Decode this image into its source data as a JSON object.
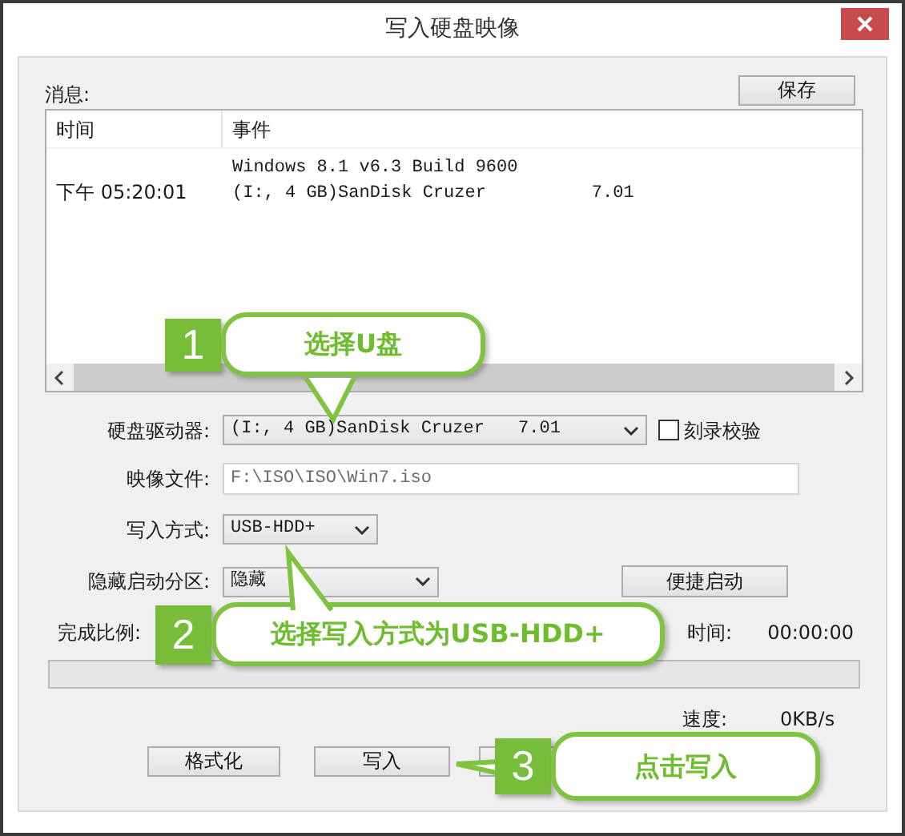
{
  "window": {
    "title": "写入硬盘映像"
  },
  "messages": {
    "label": "消息:",
    "save_button": "保存",
    "columns": [
      "时间",
      "事件"
    ],
    "rows": [
      {
        "time": "下午 05:20:01",
        "event_lines": [
          "Windows 8.1 v6.3 Build 9600",
          "(I:, 4 GB)SanDisk Cruzer          7.01"
        ]
      }
    ]
  },
  "form": {
    "drive": {
      "label": "硬盘驱动器:",
      "value": "(I:, 4 GB)SanDisk Cruzer",
      "version": "7.01",
      "verify": {
        "label": "刻录校验",
        "checked": false
      }
    },
    "image_file": {
      "label": "映像文件:",
      "value": "F:\\ISO\\ISO\\Win7.iso"
    },
    "write_method": {
      "label": "写入方式:",
      "value": "USB-HDD+"
    },
    "hidden_partition": {
      "label": "隐藏启动分区:",
      "value": "隐藏"
    },
    "quick_boot_button": "便捷启动"
  },
  "progress": {
    "label": "完成比例:",
    "remaining_label": "时间:",
    "remaining_value": "00:00:00",
    "level": 0,
    "speed_label": "速度:",
    "speed_value": "0KB/s"
  },
  "buttons": [
    "格式化",
    "写入"
  ],
  "callouts": [
    {
      "number": "1",
      "text": "选择U盘"
    },
    {
      "number": "2",
      "text": "选择写入方式为USB-HDD+"
    },
    {
      "number": "3",
      "text": "点击写入"
    }
  ]
}
